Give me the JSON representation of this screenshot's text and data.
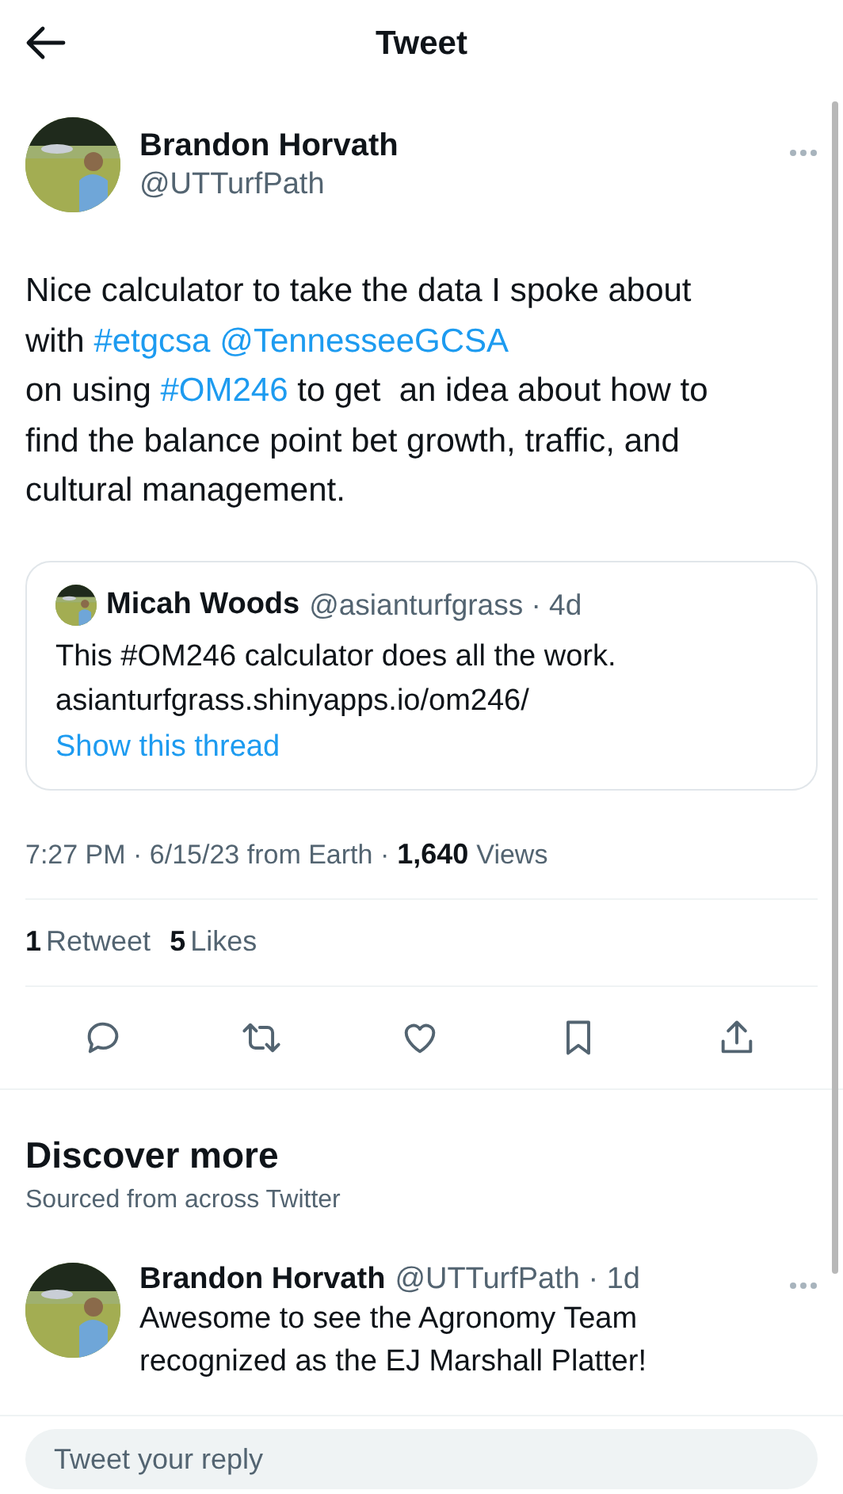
{
  "header": {
    "title": "Tweet"
  },
  "tweet": {
    "author": {
      "name": "Brandon Horvath",
      "handle": "@UTTurfPath"
    },
    "body_lines": [
      [
        {
          "kind": "text",
          "text": "Nice calculator to take the data I spoke about"
        }
      ],
      [
        {
          "kind": "text",
          "text": "with "
        },
        {
          "kind": "link",
          "text": "#etgcsa"
        },
        {
          "kind": "link",
          "text": "@TennesseeGCSA"
        }
      ],
      [
        {
          "kind": "text",
          "text": "on using "
        },
        {
          "kind": "link",
          "text": "#OM246"
        },
        {
          "kind": "text",
          "text": " to get  an idea about how to"
        }
      ],
      [
        {
          "kind": "text",
          "text": "find the balance point bet growth, traffic, and"
        }
      ],
      [
        {
          "kind": "text",
          "text": "cultural management."
        }
      ]
    ],
    "quote": {
      "name": "Micah Woods",
      "meta": "@asianturfgrass · 4d",
      "lines": [
        "This #OM246 calculator does all the work.",
        "asianturfgrass.shinyapps.io/om246/"
      ],
      "thread_link": "Show this thread"
    },
    "meta": "7:27 PM · 6/15/23 from Earth ·",
    "views_count": "1,640",
    "views_label": "Views",
    "stats": [
      {
        "count": "1",
        "label": "Retweet"
      },
      {
        "count": "5",
        "label": "Likes"
      }
    ],
    "actions": [
      {
        "kind": "reply"
      },
      {
        "kind": "retweet"
      },
      {
        "kind": "like"
      },
      {
        "kind": "bookmark"
      },
      {
        "kind": "share"
      }
    ]
  },
  "discover": {
    "title": "Discover more",
    "subtitle": "Sourced from across Twitter",
    "tweets": [
      {
        "name": "Brandon Horvath",
        "meta": "@UTTurfPath · 1d",
        "lines": [
          "Awesome to see the Agronomy Team",
          "recognized as the EJ Marshall Platter!"
        ]
      }
    ]
  },
  "reply_bar": {
    "placeholder": "Tweet your reply"
  }
}
